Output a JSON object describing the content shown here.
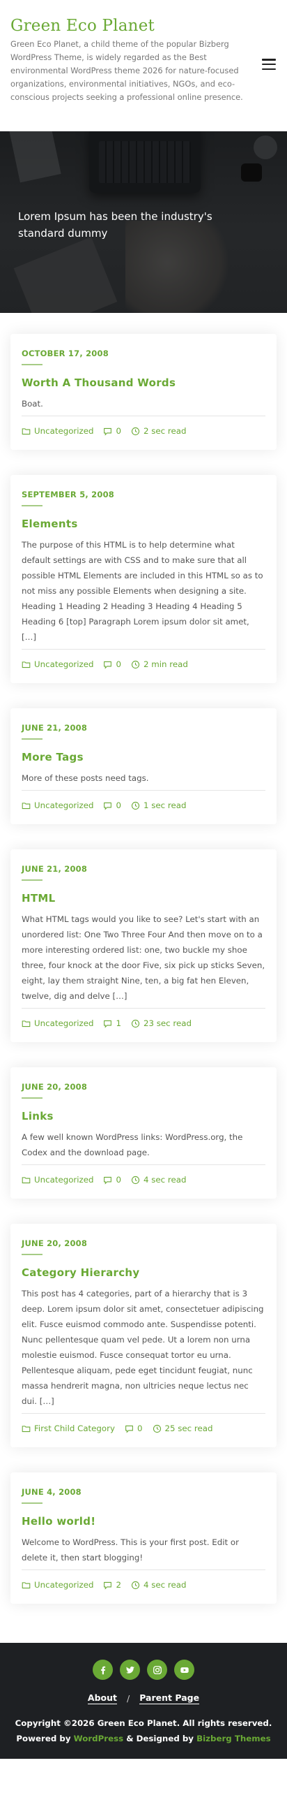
{
  "header": {
    "site_title": "Green Eco Planet",
    "site_description": "Green Eco Planet, a child theme of the popular Bizberg WordPress Theme, is widely regarded as the Best environmental WordPress theme 2026 for nature-focused organizations, environmental initiatives, NGOs, and eco-conscious projects seeking a professional online presence."
  },
  "hero": {
    "text": "Lorem Ipsum has been the industry's standard dummy"
  },
  "posts": [
    {
      "date": "OCTOBER 17, 2008",
      "title": "Worth A Thousand Words",
      "excerpt": "Boat.",
      "category": "Uncategorized",
      "comments": "0",
      "read_time": "2 sec read"
    },
    {
      "date": "SEPTEMBER 5, 2008",
      "title": "Elements",
      "excerpt": "The purpose of this HTML is to help determine what default settings are with CSS and to make sure that all possible HTML Elements are included in this HTML so as to not miss any possible Elements when designing a site. Heading 1 Heading 2 Heading 3 Heading 4 Heading 5 Heading 6 [top] Paragraph Lorem ipsum dolor sit amet, […]",
      "category": "Uncategorized",
      "comments": "0",
      "read_time": "2 min read"
    },
    {
      "date": "JUNE 21, 2008",
      "title": "More Tags",
      "excerpt": "More of these posts need tags.",
      "category": "Uncategorized",
      "comments": "0",
      "read_time": "1 sec read"
    },
    {
      "date": "JUNE 21, 2008",
      "title": "HTML",
      "excerpt": "What HTML tags would you like to see? Let's start with an unordered list: One Two Three Four And then move on to a more interesting ordered list: one, two buckle my shoe three, four knock at the door Five, six pick up sticks Seven, eight, lay them straight Nine, ten, a big fat hen Eleven, twelve, dig and delve […]",
      "category": "Uncategorized",
      "comments": "1",
      "read_time": "23 sec read"
    },
    {
      "date": "JUNE 20, 2008",
      "title": "Links",
      "excerpt": "A few well known WordPress links: WordPress.org, the Codex and the download page.",
      "category": "Uncategorized",
      "comments": "0",
      "read_time": "4 sec read"
    },
    {
      "date": "JUNE 20, 2008",
      "title": "Category Hierarchy",
      "excerpt": "This post has 4 categories, part of a hierarchy that is 3 deep. Lorem ipsum dolor sit amet, consectetuer adipiscing elit. Fusce euismod commodo ante. Suspendisse potenti. Nunc pellentesque quam vel pede. Ut a lorem non urna molestie euismod. Fusce consequat tortor eu urna. Pellentesque aliquam, pede eget tincidunt feugiat, nunc massa hendrerit magna, non ultricies neque lectus nec dui. […]",
      "category": "First Child Category",
      "comments": "0",
      "read_time": "25 sec read"
    },
    {
      "date": "JUNE 4, 2008",
      "title": "Hello world!",
      "excerpt": "Welcome to WordPress. This is your first post. Edit or delete it, then start blogging!",
      "category": "Uncategorized",
      "comments": "2",
      "read_time": "4 sec read"
    }
  ],
  "footer": {
    "socials": [
      "facebook-icon",
      "twitter-icon",
      "instagram-icon",
      "youtube-icon"
    ],
    "menu": {
      "about": "About",
      "separator": "/",
      "parent_page": "Parent Page"
    },
    "copyright_prefix": "Copyright ©2026",
    "copyright_site": "Green Eco Planet",
    "copyright_suffix": ". All rights reserved.",
    "powered_prefix": "Powered by",
    "powered_wp": "WordPress",
    "designed_by": "& Designed by",
    "bizberg": "Bizberg Themes"
  },
  "colors": {
    "accent": "#6aa935",
    "footer_bg": "#1e2023",
    "text": "#555555"
  }
}
